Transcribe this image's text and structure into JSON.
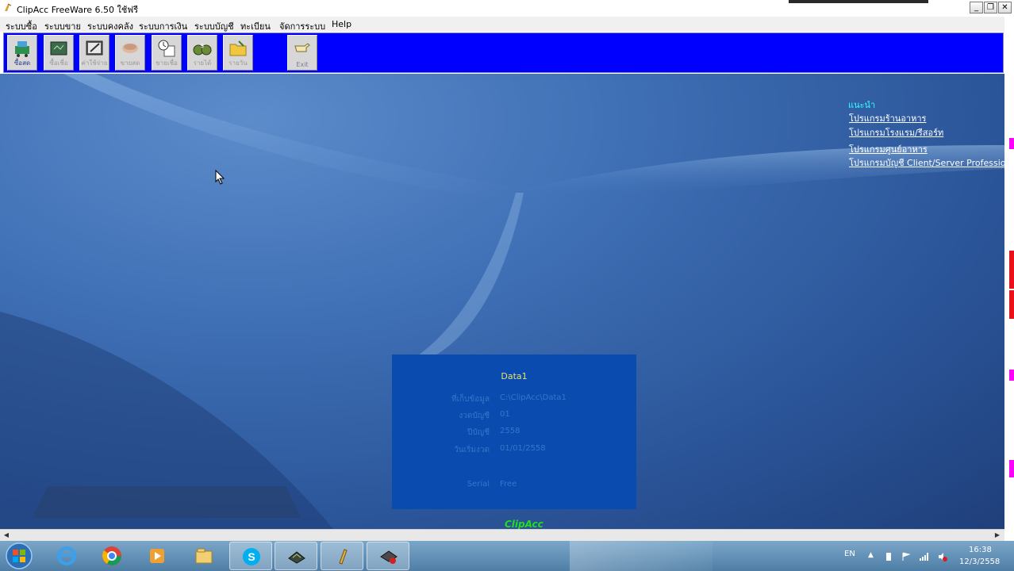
{
  "window": {
    "title": "ClipAcc FreeWare 6.50  ใช้ฟรี"
  },
  "menu": [
    "ระบบซื้อ",
    "ระบบขาย",
    "ระบบคงคลัง",
    "ระบบการเงิน",
    "ระบบบัญชี",
    "ทะเบียน",
    "จัดการระบบ",
    "Help"
  ],
  "toolbar": {
    "buttons": [
      {
        "label": "ซื้อสด",
        "icon": "cart-icon"
      },
      {
        "label": "ซื้อเชื่อ",
        "icon": "ledger-icon"
      },
      {
        "label": "ค่าใช้จ่าย",
        "icon": "note-edit-icon"
      },
      {
        "label": "ขายสด",
        "icon": "money-icon"
      },
      {
        "label": "ขายเชื่อ",
        "icon": "invoice-icon"
      },
      {
        "label": "รายได้",
        "icon": "money-bags-icon"
      },
      {
        "label": "รายวัน",
        "icon": "folder-icon"
      },
      {
        "label": "Exit",
        "icon": "exit-hand-icon"
      }
    ]
  },
  "recommend": {
    "heading": "แนะนำ",
    "links": [
      "โปรแกรมร้านอาหาร",
      "โปรแกรมโรงแรม/รีสอร์ท",
      "โปรแกรมศูนย์อาหาร",
      "โปรแกรมบัญชี Client/Server Professio"
    ]
  },
  "info_panel": {
    "title": "Data1",
    "rows": [
      {
        "label": "ที่เก็บข้อมูล",
        "value": "C:\\ClipAcc\\Data1"
      },
      {
        "label": "งวดบัญชี",
        "value": "01"
      },
      {
        "label": "ปีบัญชี",
        "value": "2558"
      },
      {
        "label": "วันเริ่มงวด",
        "value": "01/01/2558"
      },
      {
        "label": "Serial",
        "value": "Free"
      }
    ]
  },
  "brand": "ClipAcc",
  "tray": {
    "lang": "EN",
    "time": "16:38",
    "date": "12/3/2558"
  },
  "taskbar": {
    "items": [
      "ie-icon",
      "chrome-icon",
      "media-player-icon",
      "file-explorer-icon",
      "skype-icon",
      "book-app-icon",
      "clip-app-icon",
      "settings-app-icon"
    ]
  },
  "colors": {
    "toolbar_bg": "#0000ff",
    "panel_bg": "#0a4bb0",
    "brand": "#22dd22",
    "heading": "#33ffff"
  }
}
